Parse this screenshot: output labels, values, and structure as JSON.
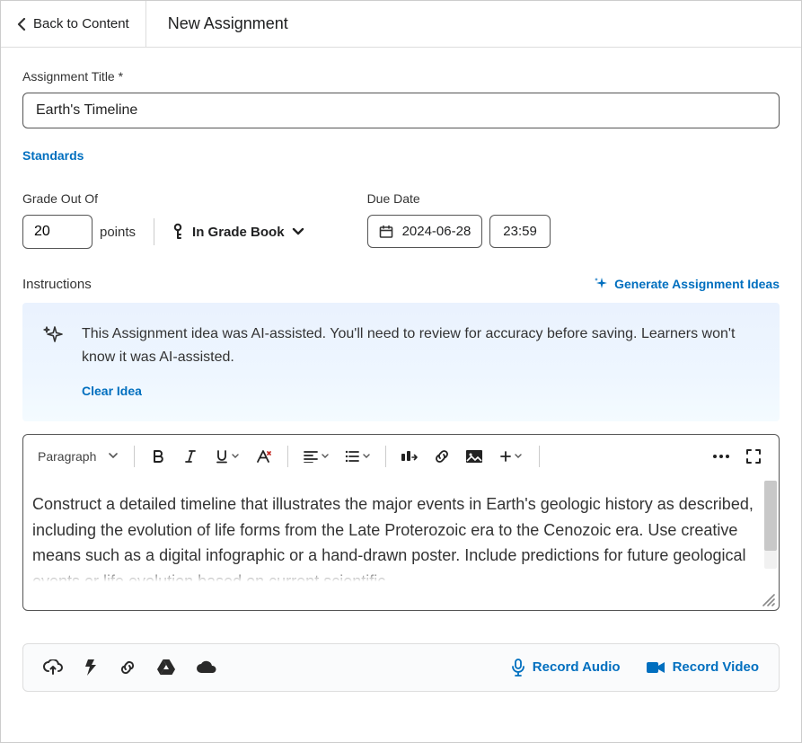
{
  "header": {
    "back_label": "Back to Content",
    "title": "New Assignment"
  },
  "title_field": {
    "label": "Assignment Title *",
    "value": "Earth's Timeline"
  },
  "standards_link": "Standards",
  "grade": {
    "label": "Grade Out Of",
    "value": "20",
    "points_label": "points",
    "gradebook_label": "In Grade Book"
  },
  "due": {
    "label": "Due Date",
    "date": "2024-06-28",
    "time": "23:59"
  },
  "instructions_label": "Instructions",
  "generate_ideas_label": "Generate Assignment Ideas",
  "ai_banner": {
    "text": "This Assignment idea was AI-assisted. You'll need to review for accuracy before saving. Learners won't know it was AI-assisted.",
    "clear_label": "Clear Idea"
  },
  "editor": {
    "format_label": "Paragraph",
    "body": "Construct a detailed timeline that illustrates the major events in Earth's geologic history as described, including the evolution of life forms from the Late Proterozoic era to the Cenozoic era. Use creative means such as a digital infographic or a hand-drawn poster. Include predictions for future geological events or life evolution based on current scientific"
  },
  "attach": {
    "record_audio": "Record Audio",
    "record_video": "Record Video"
  }
}
